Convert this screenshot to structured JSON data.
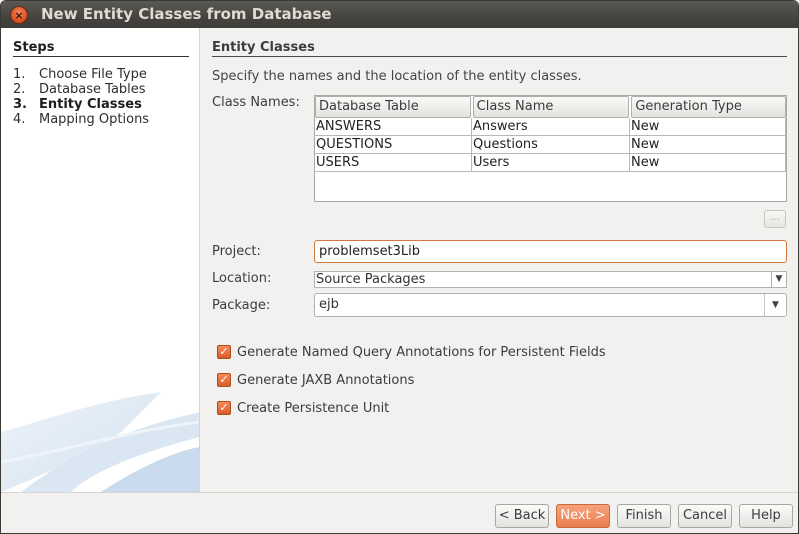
{
  "window": {
    "title": "New Entity Classes from Database",
    "close_glyph": "×"
  },
  "steps": {
    "title": "Steps",
    "items": [
      {
        "num": "1.",
        "label": "Choose File Type",
        "active": false
      },
      {
        "num": "2.",
        "label": "Database Tables",
        "active": false
      },
      {
        "num": "3.",
        "label": "Entity Classes",
        "active": true
      },
      {
        "num": "4.",
        "label": "Mapping Options",
        "active": false
      }
    ]
  },
  "entity": {
    "title": "Entity Classes",
    "description": "Specify the names and the location of the entity classes.",
    "class_names_label": "Class Names:",
    "columns": [
      "Database Table",
      "Class Name",
      "Generation Type"
    ],
    "rows": [
      [
        "ANSWERS",
        "Answers",
        "New"
      ],
      [
        "QUESTIONS",
        "Questions",
        "New"
      ],
      [
        "USERS",
        "Users",
        "New"
      ]
    ],
    "more_button": "..."
  },
  "form": {
    "project_label": "Project:",
    "project_value": "problemset3Lib",
    "location_label": "Location:",
    "location_value": "Source Packages",
    "package_label": "Package:",
    "package_value": "ejb"
  },
  "options": [
    {
      "label": "Generate Named Query Annotations for Persistent Fields",
      "checked": true
    },
    {
      "label": "Generate JAXB Annotations",
      "checked": true
    },
    {
      "label": "Create Persistence Unit",
      "checked": true
    }
  ],
  "buttons": {
    "back": "< Back",
    "next": "Next >",
    "finish": "Finish",
    "cancel": "Cancel",
    "help": "Help"
  },
  "colors": {
    "accent": "#ea7f4f",
    "title_bar": "#45443f",
    "check": "#d95c2a"
  }
}
